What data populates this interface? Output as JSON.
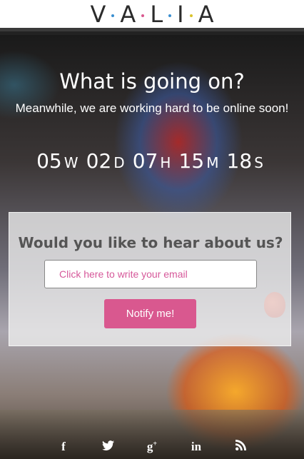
{
  "header": {
    "logo_letters": [
      "V",
      "A",
      "L",
      "I",
      "A"
    ],
    "dot_colors": [
      "#3a8fd0",
      "#d9588f",
      "#3a8fd0",
      "#d9c32b"
    ]
  },
  "hero": {
    "headline": "What is going on?",
    "subline": "Meanwhile, we are working hard to be online soon!"
  },
  "countdown": {
    "weeks": "05",
    "weeks_unit": "W",
    "days": "02",
    "days_unit": "D",
    "hours": "07",
    "hours_unit": "H",
    "minutes": "15",
    "minutes_unit": "M",
    "seconds": "18",
    "seconds_unit": "S"
  },
  "subscribe": {
    "title": "Would you like to hear about us?",
    "email_placeholder": "Click here to write your email",
    "button_label": "Notify me!"
  },
  "social": {
    "icons": [
      "facebook-icon",
      "twitter-icon",
      "google-plus-icon",
      "linkedin-icon",
      "rss-icon"
    ],
    "glyphs": [
      "f",
      "t",
      "g+",
      "in",
      "rss"
    ]
  }
}
